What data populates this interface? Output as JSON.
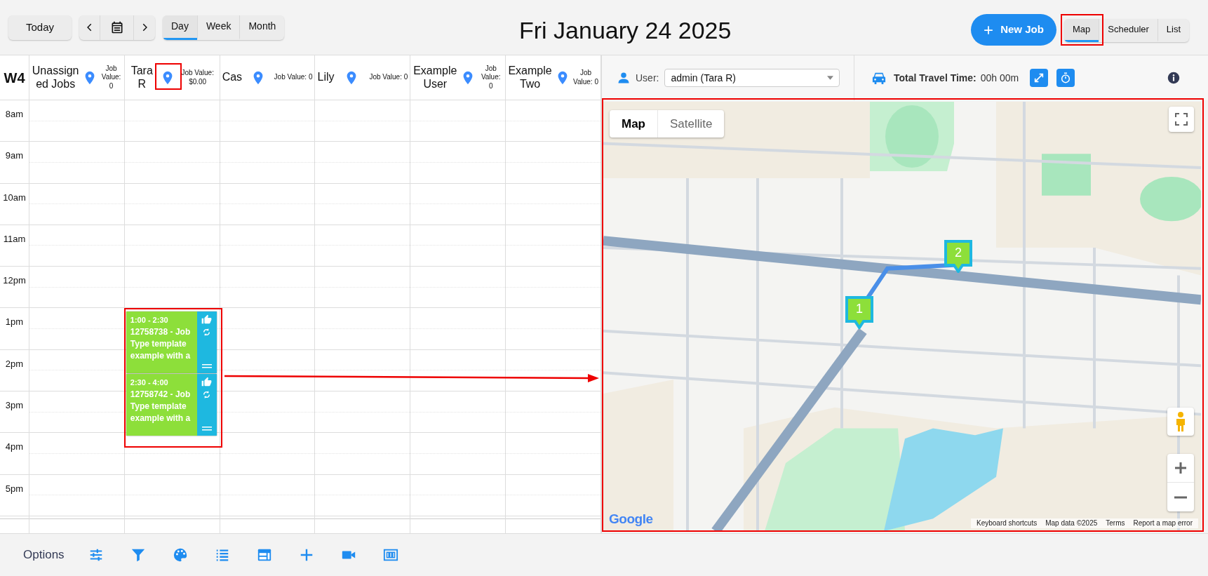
{
  "toolbar": {
    "today": "Today",
    "views": [
      {
        "label": "Day",
        "selected": true
      },
      {
        "label": "Week",
        "selected": false
      },
      {
        "label": "Month",
        "selected": false
      }
    ],
    "title": "Fri January 24 2025",
    "new_job": "New Job",
    "modes": [
      {
        "label": "Map",
        "selected": true
      },
      {
        "label": "Scheduler",
        "selected": false
      },
      {
        "label": "List",
        "selected": false
      }
    ]
  },
  "calendar": {
    "week": "W4",
    "hours": [
      "8am",
      "9am",
      "10am",
      "11am",
      "12pm",
      "1pm",
      "2pm",
      "3pm",
      "4pm",
      "5pm"
    ],
    "resources": [
      {
        "name": "Unassigned Jobs",
        "job_value": "Job Value: 0"
      },
      {
        "name": "Tara R",
        "job_value": "Job Value: $0.00",
        "jobs": [
          {
            "time": "1:00 - 2:30",
            "text": "12758738 - Job Type template example with a"
          },
          {
            "time": "2:30 - 4:00",
            "text": "12758742 - Job Type template example with a"
          }
        ]
      },
      {
        "name": "Cas",
        "job_value": "Job Value: 0"
      },
      {
        "name": "Lily",
        "job_value": "Job Value: 0"
      },
      {
        "name": "Example User",
        "job_value": "Job Value: 0"
      },
      {
        "name": "Example Two",
        "job_value": "Job Value: 0"
      }
    ]
  },
  "map_panel": {
    "user_label": "User:",
    "user_value": "admin (Tara R)",
    "travel_label": "Total Travel Time:",
    "travel_value": "00h 00m",
    "map": {
      "types": [
        {
          "label": "Map",
          "selected": true
        },
        {
          "label": "Satellite",
          "selected": false
        }
      ],
      "markers": [
        "1",
        "2"
      ],
      "logo": "Google",
      "attribution": [
        "Keyboard shortcuts",
        "Map data ©2025",
        "Terms",
        "Report a map error"
      ]
    }
  },
  "bottom_bar": {
    "label": "Options"
  }
}
